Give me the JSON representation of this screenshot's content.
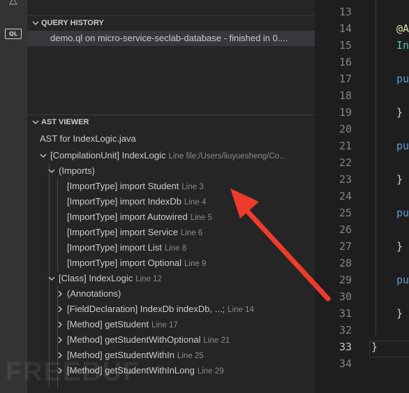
{
  "activity_bar": {
    "icons": [
      "search-icon",
      "codeql-icon"
    ],
    "ql_label": "QL"
  },
  "query_history": {
    "title": "QUERY HISTORY",
    "items": [
      {
        "text": "demo.ql on micro-service-seclab-database - finished in 0...."
      }
    ]
  },
  "ast_viewer": {
    "title": "AST VIEWER",
    "root_label": "AST for IndexLogic.java",
    "nodes": [
      {
        "label": "[CompilationUnit] IndexLogic",
        "detail": "Line file:/Users/liuyuesheng/Co...",
        "state": "expanded"
      },
      {
        "label": "(Imports)",
        "detail": "",
        "state": "expanded"
      },
      {
        "label": "[ImportType] import Student",
        "detail": "Line 3",
        "state": "leaf"
      },
      {
        "label": "[ImportType] import IndexDb",
        "detail": "Line 4",
        "state": "leaf"
      },
      {
        "label": "[ImportType] import Autowired",
        "detail": "Line 5",
        "state": "leaf"
      },
      {
        "label": "[ImportType] import Service",
        "detail": "Line 6",
        "state": "leaf"
      },
      {
        "label": "[ImportType] import List",
        "detail": "Line 8",
        "state": "leaf"
      },
      {
        "label": "[ImportType] import Optional",
        "detail": "Line 9",
        "state": "leaf"
      },
      {
        "label": "[Class] IndexLogic",
        "detail": "Line 12",
        "state": "expanded"
      },
      {
        "label": "(Annotations)",
        "detail": "",
        "state": "collapsed"
      },
      {
        "label": "[FieldDeclaration] IndexDb indexDb, ...;",
        "detail": "Line 14",
        "state": "collapsed"
      },
      {
        "label": "[Method] getStudent",
        "detail": "Line 17",
        "state": "collapsed"
      },
      {
        "label": "[Method] getStudentWithOptional",
        "detail": "Line 21",
        "state": "collapsed"
      },
      {
        "label": "[Method] getStudentWithIn",
        "detail": "Line 25",
        "state": "collapsed"
      },
      {
        "label": "[Method] getStudentWithInLong",
        "detail": "Line 29",
        "state": "collapsed"
      }
    ]
  },
  "editor": {
    "line_numbers": [
      "13",
      "14",
      "15",
      "16",
      "17",
      "18",
      "19",
      "20",
      "21",
      "22",
      "23",
      "24",
      "25",
      "26",
      "27",
      "28",
      "29",
      "30",
      "31",
      "32",
      "33",
      "34"
    ],
    "active_line": "33",
    "code_lines": [
      {
        "line": "14",
        "text": "@A",
        "color": "#dcdcaa"
      },
      {
        "line": "15",
        "text": "In",
        "color": "#4ec9b0"
      },
      {
        "line": "17",
        "text": "pu",
        "color": "#569cd6"
      },
      {
        "line": "19",
        "text": "}",
        "color": "#d4d4d4"
      },
      {
        "line": "21",
        "text": "pu",
        "color": "#569cd6"
      },
      {
        "line": "23",
        "text": "}",
        "color": "#d4d4d4"
      },
      {
        "line": "25",
        "text": "pu",
        "color": "#569cd6"
      },
      {
        "line": "27",
        "text": "}",
        "color": "#d4d4d4"
      },
      {
        "line": "29",
        "text": "pu",
        "color": "#569cd6"
      },
      {
        "line": "31",
        "text": "}",
        "color": "#d4d4d4"
      },
      {
        "line": "33",
        "text": "}",
        "color": "#d4d4d4"
      }
    ]
  },
  "annotation_arrow_color": "#ef3b2c",
  "watermark": "FREEBUF",
  "colors": {
    "sidebar_bg": "#252526",
    "editor_bg": "#1e1e1e",
    "activity_bg": "#333333",
    "selection_bg": "#37373d",
    "detail_text": "#8b8b8b"
  }
}
